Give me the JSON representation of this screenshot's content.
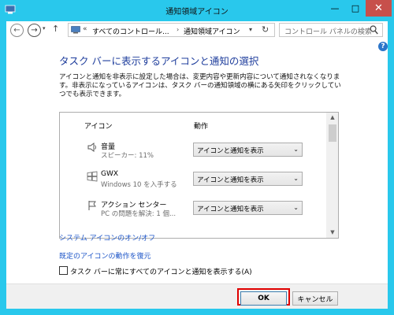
{
  "window": {
    "title": "通知領域アイコン",
    "minimize_glyph": "—",
    "maximize_glyph": "□",
    "close_glyph": "✕"
  },
  "nav": {
    "back_glyph": "←",
    "forward_glyph": "→",
    "recent_glyph": "▾",
    "up_glyph": "↑"
  },
  "address": {
    "chevron": "«",
    "part1": "すべてのコントロール...",
    "separator": "›",
    "part2": "通知領域アイコン",
    "dropdown_glyph": "▾",
    "refresh_glyph": "↻"
  },
  "search": {
    "placeholder": "コントロール パネルの検索"
  },
  "help_glyph": "?",
  "main": {
    "heading": "タスク バーに表示するアイコンと通知の選択",
    "description": "アイコンと通知を非表示に設定した場合は、変更内容や更新内容について通知されなくなります。非表示になっているアイコンは、タスク バーの通知領域の横にある矢印をクリックしていつでも表示できます。"
  },
  "table": {
    "col_icon": "アイコン",
    "col_action": "動作",
    "rows": [
      {
        "name": "音量",
        "sub": "スピーカー: 11%",
        "action": "アイコンと通知を表示",
        "icon": "speaker-icon"
      },
      {
        "name": "GWX",
        "sub": "Windows 10 を入手する",
        "action": "アイコンと通知を表示",
        "icon": "windows-logo-icon"
      },
      {
        "name": "アクション センター",
        "sub": "PC の問題を解決: 1 個...",
        "action": "アイコンと通知を表示",
        "icon": "flag-icon"
      }
    ],
    "scroll_up": "▲",
    "scroll_down": "▼"
  },
  "links": {
    "system_icons": "システム アイコンのオン/オフ",
    "restore_default": "既定のアイコンの動作を復元"
  },
  "checkbox": {
    "label": "タスク バーに常にすべてのアイコンと通知を表示する(A)"
  },
  "buttons": {
    "ok": "OK",
    "cancel": "キャンセル"
  },
  "chevron_glyph": "⌄",
  "colors": {
    "frame": "#29c8ec",
    "close": "#c7504b",
    "heading": "#1e3d9c",
    "link": "#1e56c8",
    "highlight": "#e00000"
  }
}
